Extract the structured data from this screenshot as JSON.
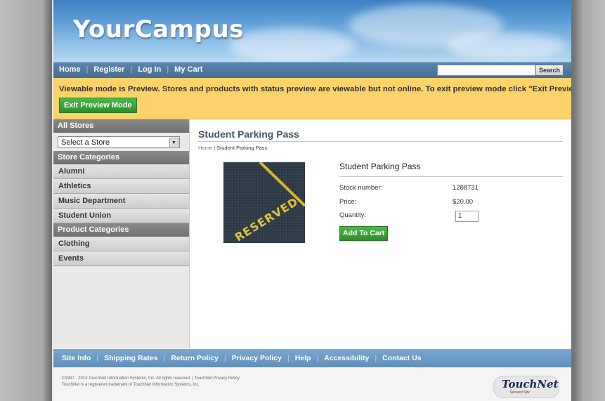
{
  "header": {
    "site_title": "YourCampus"
  },
  "topnav": {
    "links": [
      "Home",
      "Register",
      "Log In",
      "My Cart"
    ],
    "search_placeholder": "",
    "search_button": "Search"
  },
  "preview": {
    "message": "Viewable mode is Preview. Stores and products with status preview are viewable but not online. To exit preview mode click \"Exit Preview Mode\".",
    "exit_button": "Exit Preview Mode"
  },
  "sidebar": {
    "all_stores_heading": "All Stores",
    "store_select_value": "Select a Store",
    "store_categories_heading": "Store Categories",
    "store_categories": [
      "Alumni",
      "Athletics",
      "Music Department",
      "Student Union"
    ],
    "product_categories_heading": "Product Categories",
    "product_categories": [
      "Clothing",
      "Events"
    ]
  },
  "main": {
    "page_title": "Student Parking Pass",
    "breadcrumb": {
      "home": "Home",
      "separator": " | ",
      "current": "Student Parking Pass"
    },
    "product": {
      "name": "Student Parking Pass",
      "image_text": "RESERVED",
      "stock_label": "Stock number:",
      "stock_value": "1288731",
      "price_label": "Price:",
      "price_value": "$20.00",
      "quantity_label": "Quantity:",
      "quantity_value": "1",
      "add_to_cart": "Add To Cart"
    }
  },
  "footer_nav": {
    "links": [
      "Site Info",
      "Shipping Rates",
      "Return Policy",
      "Privacy Policy",
      "Help",
      "Accessibility",
      "Contact Us"
    ]
  },
  "footer": {
    "copyright_line1": "©1997 - 2013 TouchNet Information Systems, Inc. All rights reserved. | TouchNet Privacy Policy",
    "copyright_line2": "TouchNet is a registered trademark of TouchNet Information Systems, Inc.",
    "logo_text": "TouchNet",
    "logo_subtext": "Secured Site"
  },
  "colors": {
    "preview_bar": "#fcd36a",
    "nav_blue": "#456d93",
    "button_green": "#2e8d2a",
    "title_text": "#445566"
  }
}
